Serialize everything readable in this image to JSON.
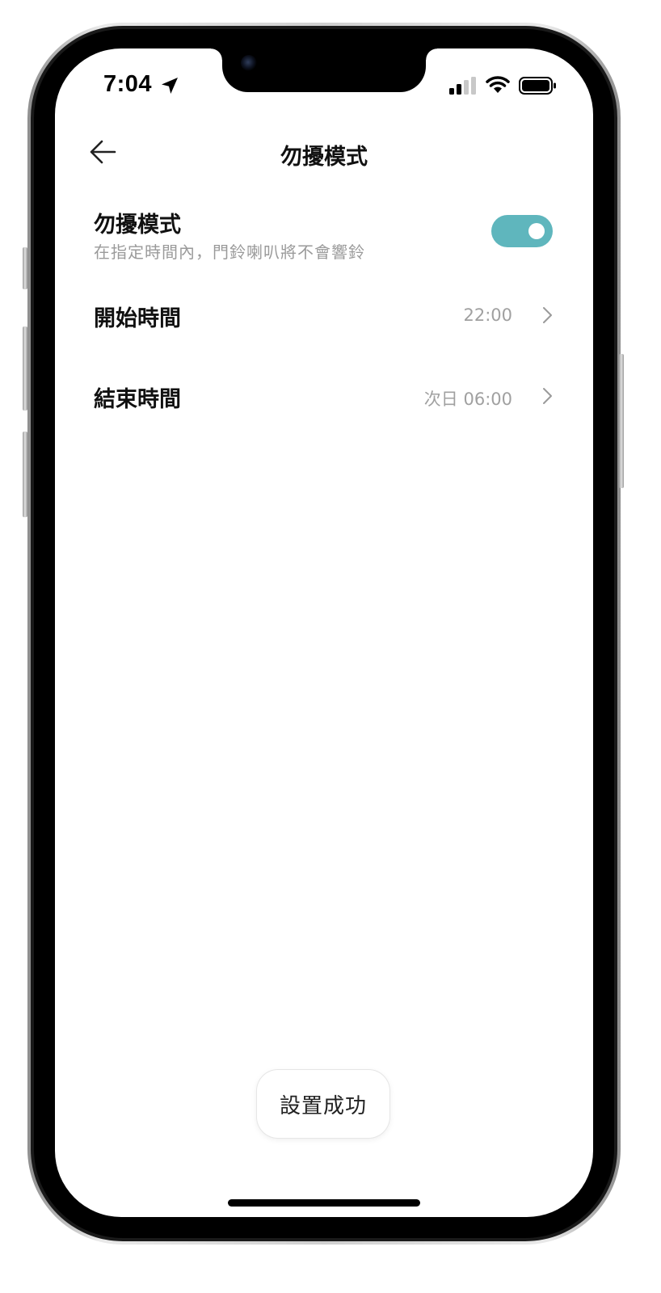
{
  "status_bar": {
    "time": "7:04",
    "location_icon": "location-arrow-icon",
    "signal_icon": "cellular-signal-icon",
    "wifi_icon": "wifi-icon",
    "battery_icon": "battery-icon"
  },
  "header": {
    "back_icon": "arrow-left-icon",
    "title": "勿擾模式"
  },
  "dnd": {
    "title": "勿擾模式",
    "subtitle": "在指定時間內，門鈴喇叭將不會響鈴",
    "enabled": true,
    "toggle_color": "#5fb6bd"
  },
  "schedule": {
    "start": {
      "label": "開始時間",
      "value": "22:00"
    },
    "end": {
      "label": "結束時間",
      "value": "次日 06:00"
    },
    "chevron_icon": "chevron-right-icon"
  },
  "toast": {
    "message": "設置成功"
  }
}
